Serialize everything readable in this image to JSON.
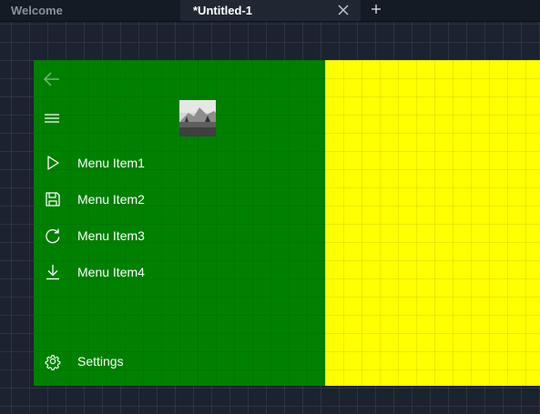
{
  "tabs": [
    {
      "label": "Welcome",
      "active": false
    },
    {
      "label": "*Untitled-1",
      "active": true
    }
  ],
  "tab_icons": {
    "close": "close-icon",
    "add": "plus-icon"
  },
  "navigation": {
    "back_icon": "arrow-left-icon",
    "menu_icon": "hamburger-icon",
    "header_image": "landscape-thumbnail",
    "items": [
      {
        "label": "Menu Item1",
        "icon": "play-icon"
      },
      {
        "label": "Menu Item2",
        "icon": "save-icon"
      },
      {
        "label": "Menu Item3",
        "icon": "refresh-icon"
      },
      {
        "label": "Menu Item4",
        "icon": "download-icon"
      }
    ],
    "settings": {
      "label": "Settings",
      "icon": "gear-icon"
    }
  },
  "colors": {
    "canvas": "#1b2330",
    "pane": "#008000",
    "content": "#ffff00",
    "text": "#ffffff"
  }
}
